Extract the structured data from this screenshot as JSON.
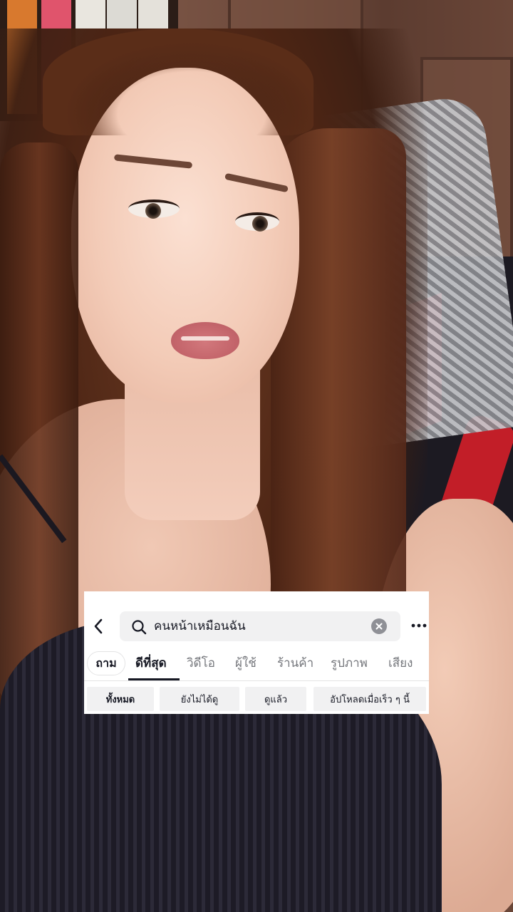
{
  "search": {
    "query": "คนหน้าเหมือนฉัน"
  },
  "tabs": [
    {
      "label": "ถาม"
    },
    {
      "label": "ดีที่สุด",
      "active": true
    },
    {
      "label": "วิดีโอ"
    },
    {
      "label": "ผู้ใช้"
    },
    {
      "label": "ร้านค้า"
    },
    {
      "label": "รูปภาพ"
    },
    {
      "label": "เสียง"
    }
  ],
  "filters": [
    {
      "label": "ทั้งหมด",
      "active": true
    },
    {
      "label": "ยังไม่ได้ดู"
    },
    {
      "label": "ดูแล้ว"
    },
    {
      "label": "อัปโหลดเมื่อเร็ว ๆ นี้"
    }
  ],
  "icons": {
    "back": "chevron-left-icon",
    "search": "search-icon",
    "clear": "clear-icon",
    "more": "more-horizontal-icon"
  }
}
